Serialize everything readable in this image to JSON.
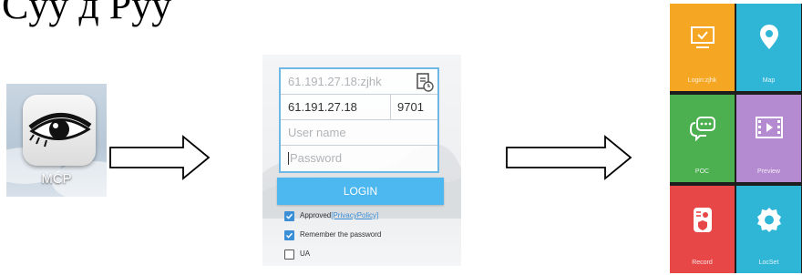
{
  "caption": "Cyy д         Pyy",
  "app_icon": {
    "label": "MCP",
    "icon": "eye-icon"
  },
  "login": {
    "server_placeholder": "61.191.27.18:zjhk",
    "ip_value": "61.191.27.18",
    "port_value": "9701",
    "username_placeholder": "User name",
    "password_placeholder": "Password",
    "login_label": "LOGIN",
    "approved_label": "Approved",
    "privacy_link": "[PrivacyPolicy]",
    "remember_label": "Remember the password",
    "ua_label": "UA",
    "history_icon": "history-icon",
    "checks": {
      "approved": true,
      "remember": true,
      "ua": false
    }
  },
  "menu": {
    "tiles": [
      {
        "label": "Login:zjhk",
        "color": "#f5a623",
        "icon": "monitor-check-icon"
      },
      {
        "label": "Map",
        "color": "#2fb6d6",
        "icon": "location-pin-icon"
      },
      {
        "label": "POC",
        "color": "#4caf50",
        "icon": "chat-bubble-icon"
      },
      {
        "label": "Preview",
        "color": "#b48ad0",
        "icon": "film-play-icon"
      },
      {
        "label": "Record",
        "color": "#e84747",
        "icon": "camera-record-icon"
      },
      {
        "label": "LocSet",
        "color": "#2fb6d6",
        "icon": "gear-icon"
      }
    ]
  }
}
